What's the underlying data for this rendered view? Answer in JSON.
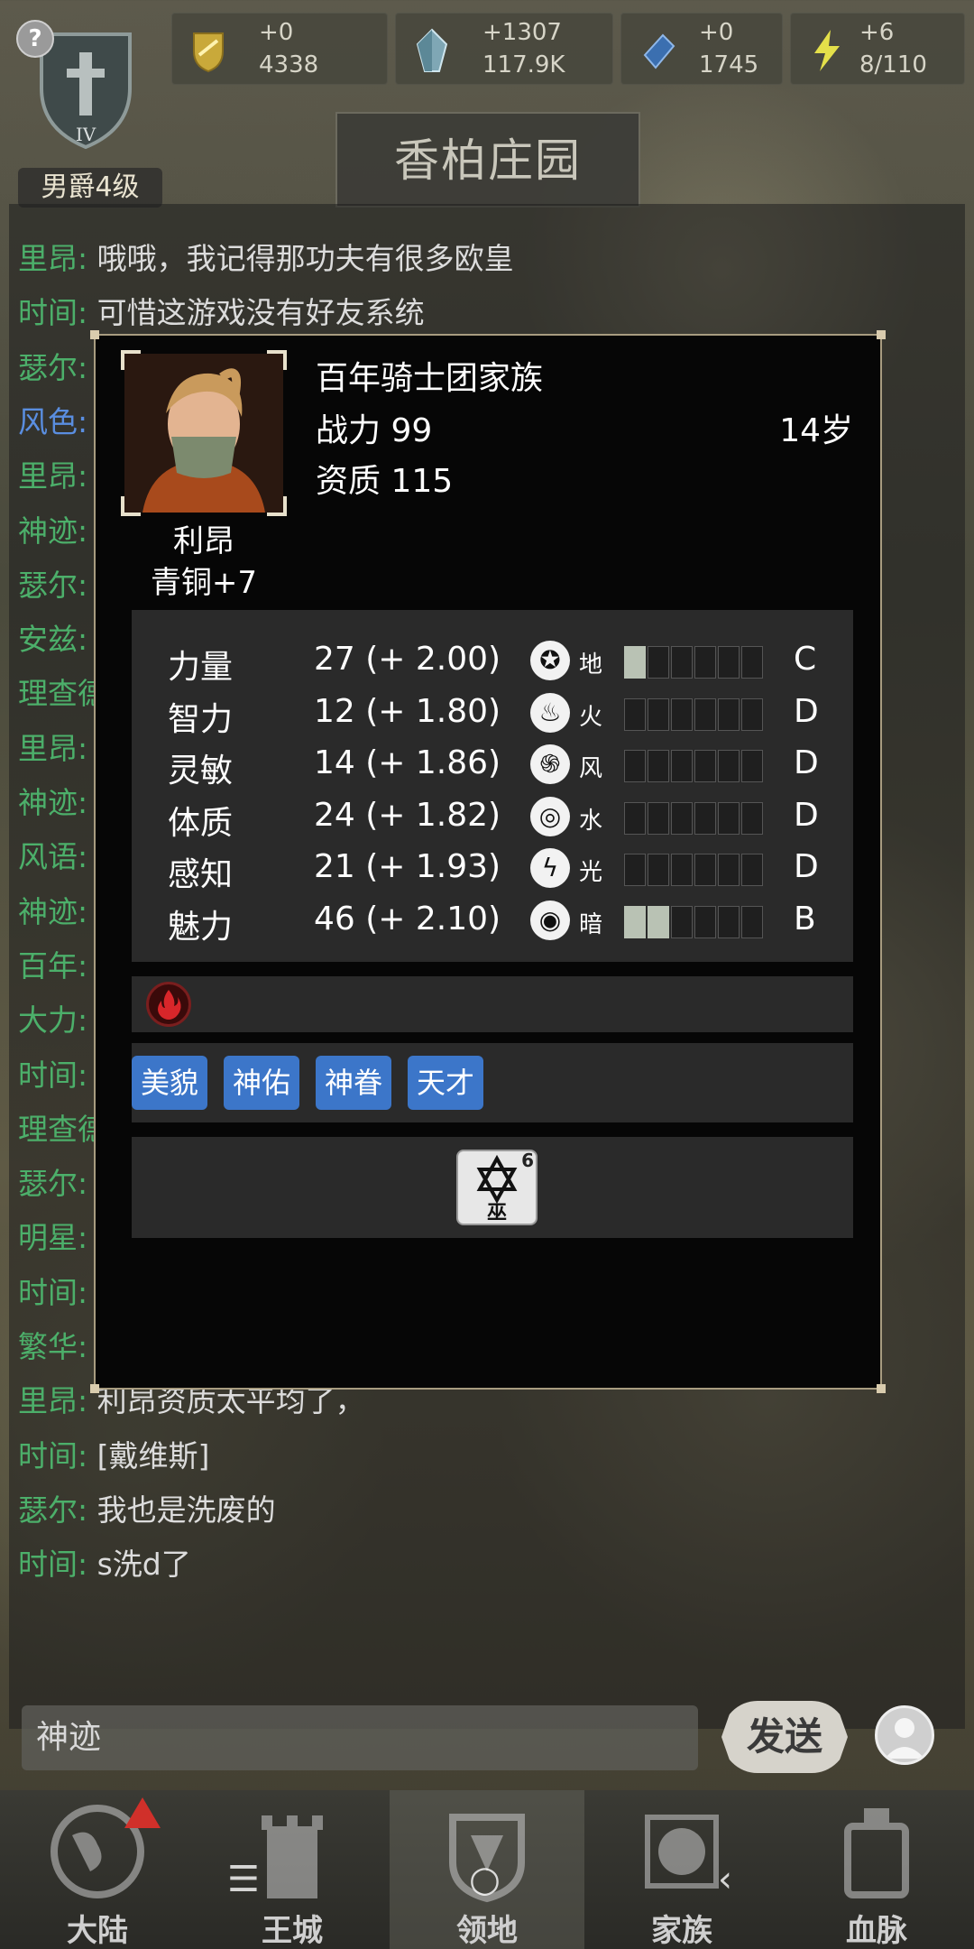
{
  "topbar": {
    "help_label": "?",
    "rank_label": "男爵4级",
    "resources": [
      {
        "icon": "shield-coin-icon",
        "delta": "+0",
        "total": "4338"
      },
      {
        "icon": "crystal-icon",
        "delta": "+1307",
        "total": "117.9K"
      },
      {
        "icon": "blue-gem-icon",
        "delta": "+0",
        "total": "1745"
      },
      {
        "icon": "lightning-icon",
        "delta": "+6",
        "total": "8/110"
      }
    ],
    "estate_title": "香柏庄园"
  },
  "chat": {
    "lines": [
      {
        "speaker": "里昂",
        "text": "哦哦，我记得那功夫有很多欧皇"
      },
      {
        "speaker": "时间",
        "text": "可惜这游戏没有好友系统"
      },
      {
        "speaker": "瑟尔",
        "text": ""
      },
      {
        "speaker": "风色",
        "text": "",
        "blue": true
      },
      {
        "speaker": "里昂",
        "text": ""
      },
      {
        "speaker": "神迹",
        "text": ""
      },
      {
        "speaker": "瑟尔",
        "text": ""
      },
      {
        "speaker": "安兹",
        "text": ""
      },
      {
        "speaker": "理查德",
        "text": ""
      },
      {
        "speaker": "里昂",
        "text": ""
      },
      {
        "speaker": "神迹",
        "text": ""
      },
      {
        "speaker": "风语",
        "text": ""
      },
      {
        "speaker": "神迹",
        "text": ""
      },
      {
        "speaker": "百年",
        "text": ""
      },
      {
        "speaker": "大力",
        "text": ""
      },
      {
        "speaker": "时间",
        "text": ""
      },
      {
        "speaker": "理查德",
        "text": ""
      },
      {
        "speaker": "瑟尔",
        "text": ""
      },
      {
        "speaker": "明星",
        "text": ""
      },
      {
        "speaker": "时间",
        "text": ""
      },
      {
        "speaker": "繁华",
        "text": ""
      },
      {
        "speaker": "里昂",
        "text": "利昂资质太平均了，"
      },
      {
        "speaker": "时间",
        "text": "[戴维斯]"
      },
      {
        "speaker": "瑟尔",
        "text": "我也是洗废的"
      },
      {
        "speaker": "时间",
        "text": "s洗d了"
      }
    ],
    "input_value": "神迹",
    "send_label": "发送"
  },
  "nav": {
    "items": [
      {
        "label": "大陆",
        "icon": "globe-icon"
      },
      {
        "label": "王城",
        "icon": "castle-icon"
      },
      {
        "label": "领地",
        "icon": "territory-icon"
      },
      {
        "label": "家族",
        "icon": "lion-crest-icon"
      },
      {
        "label": "血脉",
        "icon": "bloodline-icon"
      }
    ],
    "active_index": 2
  },
  "character": {
    "family": "百年骑士团家族",
    "power": "战力 99",
    "aptitude": "资质 115",
    "age": "14岁",
    "name": "利昂",
    "rank": "青铜+7",
    "stats": [
      {
        "name": "力量",
        "value": "27 (+ 2.00)",
        "element": "地",
        "element_icon": "earth-icon",
        "level": 1,
        "max_level": 6,
        "grade": "C"
      },
      {
        "name": "智力",
        "value": "12 (+ 1.80)",
        "element": "火",
        "element_icon": "fire-icon",
        "level": 0,
        "max_level": 6,
        "grade": "D"
      },
      {
        "name": "灵敏",
        "value": "14 (+ 1.86)",
        "element": "风",
        "element_icon": "wind-icon",
        "level": 0,
        "max_level": 6,
        "grade": "D"
      },
      {
        "name": "体质",
        "value": "24 (+ 1.82)",
        "element": "水",
        "element_icon": "water-icon",
        "level": 0,
        "max_level": 6,
        "grade": "D"
      },
      {
        "name": "感知",
        "value": "21 (+ 1.93)",
        "element": "光",
        "element_icon": "light-icon",
        "level": 0,
        "max_level": 6,
        "grade": "D"
      },
      {
        "name": "魅力",
        "value": "46 (+ 2.10)",
        "element": "暗",
        "element_icon": "dark-icon",
        "level": 2,
        "max_level": 6,
        "grade": "B"
      }
    ],
    "traits": [
      "美貌",
      "神佑",
      "神眷",
      "天才"
    ],
    "skill": {
      "name": "巫",
      "level": "6",
      "icon": "hexagram-icon"
    }
  }
}
